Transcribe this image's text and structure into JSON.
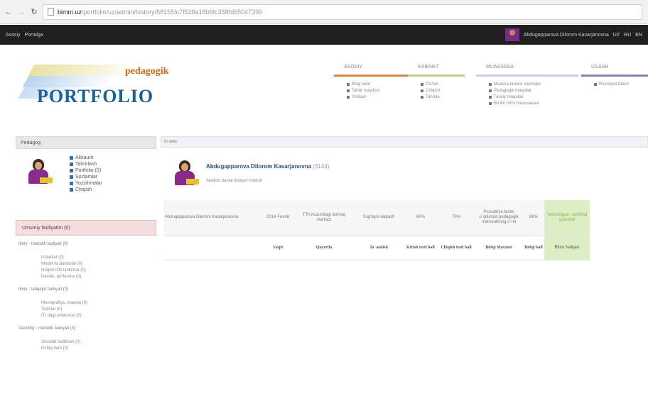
{
  "browser": {
    "url_host": "bimm.uz",
    "url_path": "/portfolio/uz/admin/history/58155fc7f528a18b9fc358fd65047390"
  },
  "topbar": {
    "links": [
      "Asosiy",
      "Portalga"
    ],
    "user": "Abdugapparova Dilorom Kasarjanovna",
    "langs": [
      "UZ",
      "RU",
      "EN"
    ]
  },
  "logo": {
    "line1": "pedagogik",
    "line2": "PORTFOLIO"
  },
  "menus": [
    {
      "title": "ASOSIY",
      "color": "#d58a4a",
      "items": [
        "Blog tarixi",
        "Tahrir maydoni",
        "Yordam"
      ]
    },
    {
      "title": "KABINET",
      "color": "#b9d18a",
      "items": [
        "CV/shi",
        "Chiqish",
        "Tahrirla"
      ]
    },
    {
      "title": "MUASSASA",
      "color": "#d6c6e6",
      "items": [
        "Muassa tarixini mashqlar",
        "Pedagogik maqollar",
        "Tarixiy maqollar",
        "Bo'lim mi'ni muassasasi"
      ]
    },
    {
      "title": "IZLASH",
      "color": "#8a7fb5",
      "items": [
        "Rasmiyat izlash"
      ]
    }
  ],
  "sidebar": {
    "title": "Pedagog",
    "profile_links": [
      "Akkaunt",
      "Tahrirlash",
      "Portfolio (0)",
      "Sozlamlar",
      "Yozishmalar",
      "Chiqish"
    ],
    "section_title": "Umumiy faoliyatim (0)",
    "groups": [
      {
        "label": "Ilmiy - metodik faoliyati (0)",
        "items": [
          "Ishlanlar (0)",
          "Model va dasturlar (0)",
          "Ilmgoh IOh ishlnmar (0)",
          "Darslik, qo'llanma (0)"
        ]
      },
      {
        "label": "Ilmiy - tadqiqot faoliyati (0)",
        "items": [
          "Monografiya, maqola (0)",
          "Tezislar (0)",
          "ITI dagi ishlanmar (0)"
        ]
      },
      {
        "label": "Tashkiliy - metodik faoliyati (0)",
        "items": [
          "Sinovlar tadbirlari (0)",
          "Ochiq dars (0)"
        ]
      }
    ]
  },
  "main": {
    "breadcrumb": "In web",
    "person_name": "Abdugapparova Dilorom Kasarjanovna",
    "person_id": "(3144)",
    "person_sub": "Andijon davlat tibbiyot instituti",
    "row1": [
      "Abdugapparova Dilorom Kasarjanovna",
      "2014-Fevral",
      "TTA huzuridagi tarmoq markazi",
      "Sog'liqni saqlash",
      "60%",
      "75%",
      "Psixiatriya fanini o`qitishda pedagogik mahoratining o`rni",
      "86%",
      "Tekshirilgan, sertifikat yuborildi"
    ],
    "row2": [
      "",
      "Vaqti",
      "Qayerda",
      "Ta`-nalish",
      "Kirish testi ball",
      "Chiqish testi ball",
      "Bitiqi Mavzusi",
      "Bitiqi ball",
      "Bitiru Natijasi"
    ]
  }
}
